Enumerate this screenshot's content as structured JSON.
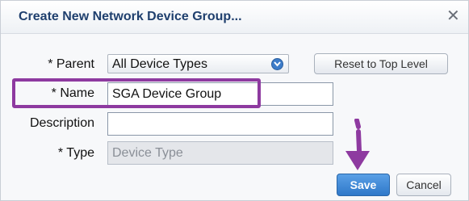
{
  "dialog": {
    "title": "Create New Network Device Group...",
    "close_icon": "close-icon"
  },
  "form": {
    "parent": {
      "label": "* Parent",
      "selected": "All Device Types"
    },
    "reset_label": "Reset to Top Level",
    "name": {
      "label": "* Name",
      "value": "SGA Device Group"
    },
    "description": {
      "label": "Description",
      "value": ""
    },
    "type": {
      "label": "* Type",
      "placeholder": "Device Type"
    }
  },
  "actions": {
    "save_label": "Save",
    "cancel_label": "Cancel"
  },
  "annotations": {
    "highlight_color": "#8e3aa0",
    "arrow_color": "#8e3aa0"
  }
}
